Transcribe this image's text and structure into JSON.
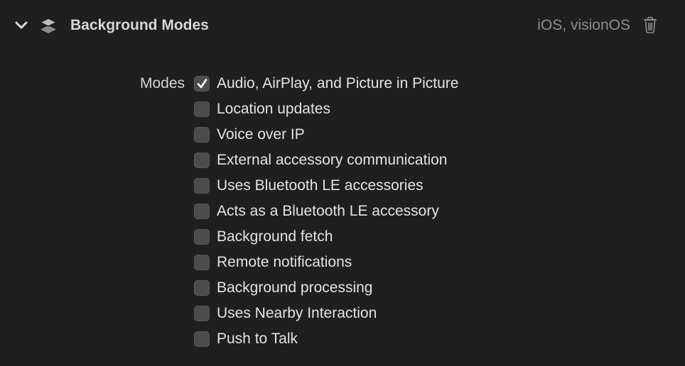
{
  "section": {
    "title": "Background Modes",
    "platforms": "iOS, visionOS",
    "expanded": true,
    "icons": {
      "disclosure": "chevron-down-icon",
      "capability": "layers-icon",
      "delete": "trash-icon"
    }
  },
  "modes": {
    "label": "Modes",
    "items": [
      {
        "label": "Audio, AirPlay, and Picture in Picture",
        "checked": true
      },
      {
        "label": "Location updates",
        "checked": false
      },
      {
        "label": "Voice over IP",
        "checked": false
      },
      {
        "label": "External accessory communication",
        "checked": false
      },
      {
        "label": "Uses Bluetooth LE accessories",
        "checked": false
      },
      {
        "label": "Acts as a Bluetooth LE accessory",
        "checked": false
      },
      {
        "label": "Background fetch",
        "checked": false
      },
      {
        "label": "Remote notifications",
        "checked": false
      },
      {
        "label": "Background processing",
        "checked": false
      },
      {
        "label": "Uses Nearby Interaction",
        "checked": false
      },
      {
        "label": "Push to Talk",
        "checked": false
      }
    ]
  },
  "colors": {
    "background": "#1e1f1e",
    "text_primary": "#d6d6d6",
    "text_secondary": "#8e8e8e",
    "checkbox_fill": "#4b4c4b"
  }
}
